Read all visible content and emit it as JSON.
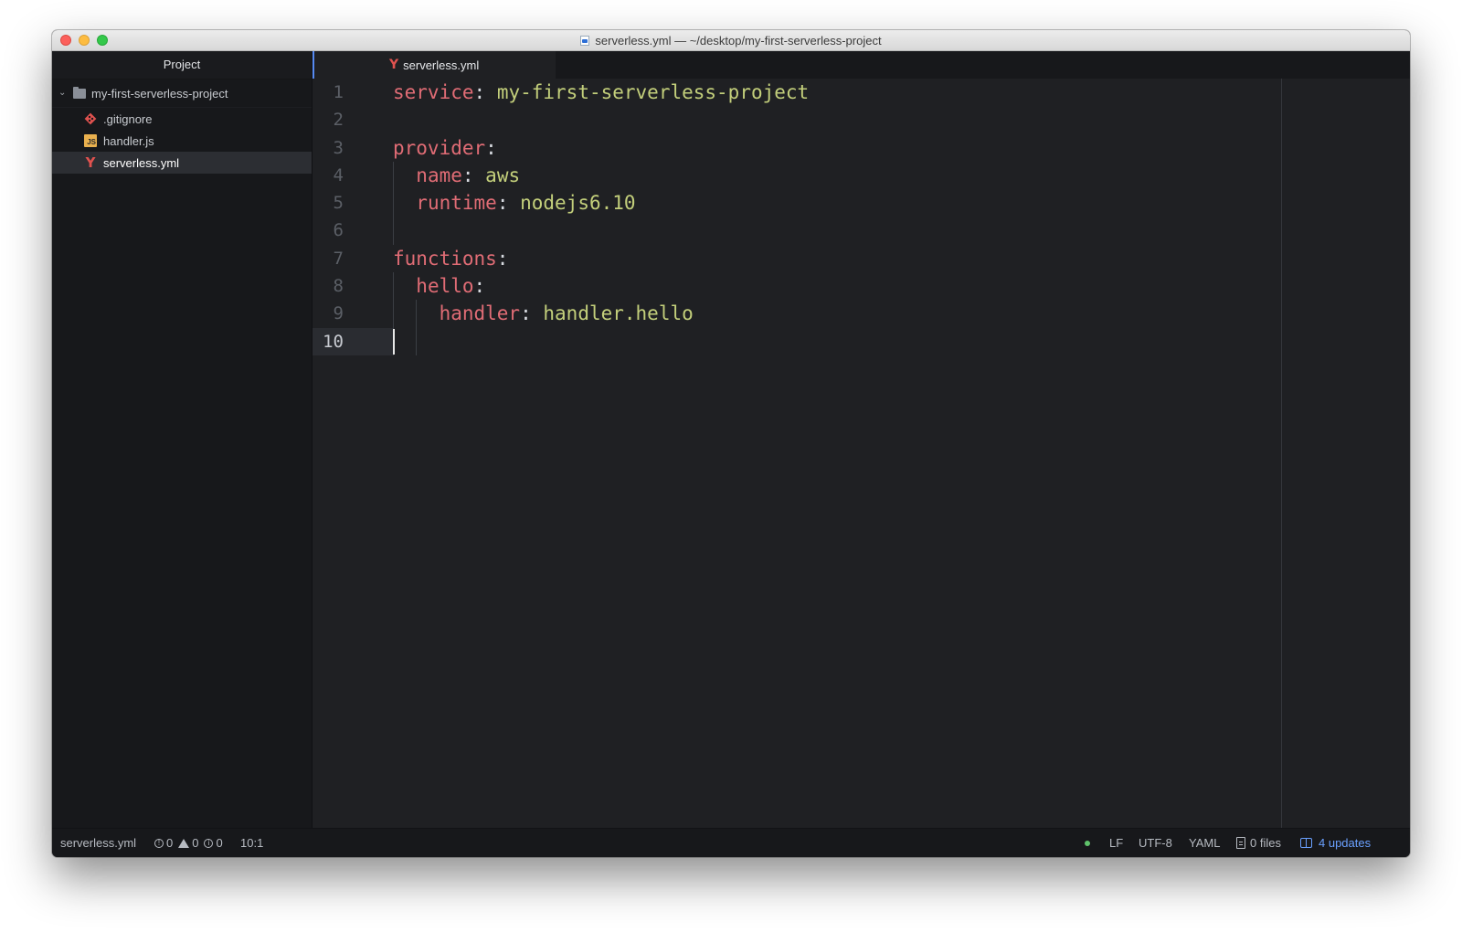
{
  "window": {
    "title": "serverless.yml — ~/desktop/my-first-serverless-project"
  },
  "sidebar": {
    "panel_title": "Project",
    "root_folder": "my-first-serverless-project",
    "files": [
      {
        "name": ".gitignore",
        "icon": "git-icon"
      },
      {
        "name": "handler.js",
        "icon": "js-icon"
      },
      {
        "name": "serverless.yml",
        "icon": "yaml-icon",
        "selected": true
      }
    ]
  },
  "editor": {
    "tab_label": "serverless.yml",
    "line_numbers": [
      "1",
      "2",
      "3",
      "4",
      "5",
      "6",
      "7",
      "8",
      "9",
      "10"
    ],
    "current_line": "10",
    "lines": [
      {
        "key": "service",
        "sep": ":",
        "value": " my-first-serverless-project"
      },
      {
        "key": "",
        "sep": "",
        "value": ""
      },
      {
        "key": "provider",
        "sep": ":",
        "value": ""
      },
      {
        "indent": "  ",
        "key": "name",
        "sep": ":",
        "value": " aws"
      },
      {
        "indent": "  ",
        "key": "runtime",
        "sep": ":",
        "value": " nodejs6.10"
      },
      {
        "key": "",
        "sep": "",
        "value": ""
      },
      {
        "key": "functions",
        "sep": ":",
        "value": ""
      },
      {
        "indent": "  ",
        "key": "hello",
        "sep": ":",
        "value": ""
      },
      {
        "indent": "    ",
        "key": "handler",
        "sep": ":",
        "value": " handler.hello"
      },
      {
        "key": "",
        "sep": "",
        "value": ""
      }
    ]
  },
  "status": {
    "file": "serverless.yml",
    "errors": "0",
    "warnings": "0",
    "infos": "0",
    "cursor": "10:1",
    "line_ending": "LF",
    "encoding": "UTF-8",
    "grammar": "YAML",
    "files_count": "0 files",
    "updates": "4 updates"
  },
  "colors": {
    "key": "#e06c75",
    "value": "#c3cf7b",
    "accent": "#568af2",
    "updates": "#6aa0ff"
  }
}
